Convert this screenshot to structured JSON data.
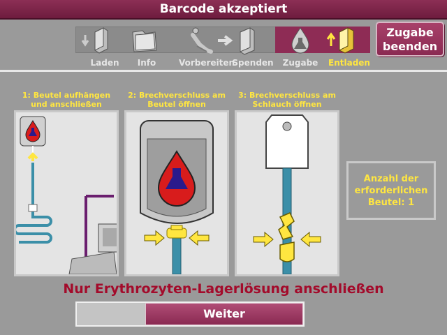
{
  "title": "Barcode akzeptiert",
  "steps": [
    {
      "label": "Laden",
      "active": false
    },
    {
      "label": "Info",
      "active": false
    },
    {
      "label": "Vorbereiten",
      "active": false
    },
    {
      "label": "Spenden",
      "active": false
    },
    {
      "label": "Zugabe",
      "active": false
    },
    {
      "label": "Entladen",
      "active": true
    }
  ],
  "end_button": {
    "line1": "Zugabe",
    "line2": "beenden"
  },
  "panels": [
    {
      "line1": "1: Beutel aufhängen",
      "line2": "und anschließen"
    },
    {
      "line1": "2: Brechverschluss am",
      "line2": "Beutel öffnen"
    },
    {
      "line1": "3: Brechverschluss am",
      "line2": "Schlauch öffnen"
    }
  ],
  "count": {
    "line1": "Anzahl der",
    "line2": "erforderlichen",
    "line3": "Beutel: 1"
  },
  "warning": "Nur Erythrozyten-Lagerlösung anschließen",
  "next_label": "Weiter",
  "colors": {
    "title": "#7a2447",
    "accent": "#ffe640",
    "warning": "#a30b2b"
  }
}
